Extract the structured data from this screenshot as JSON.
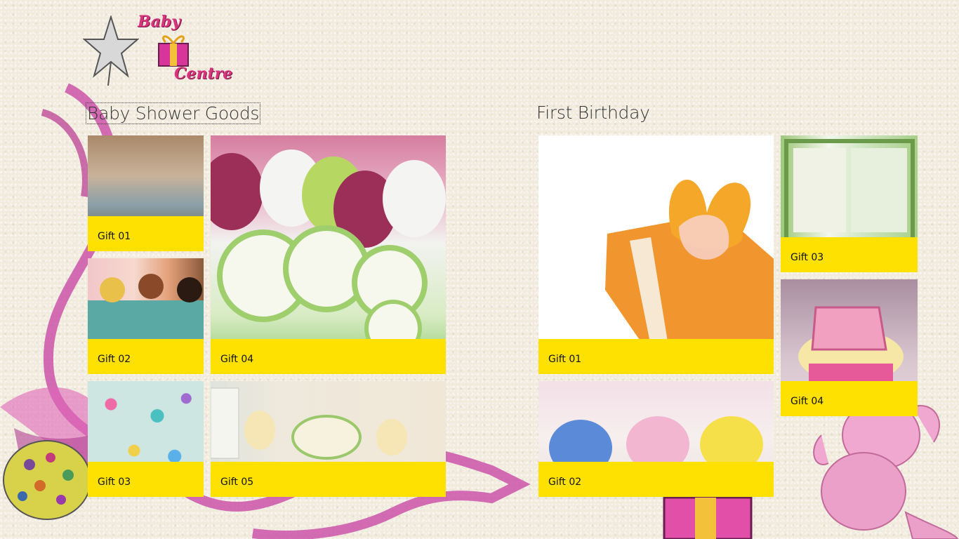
{
  "app": {
    "logo_line1": "Baby",
    "logo_line2": "Centre"
  },
  "sections": [
    {
      "title": "Baby Shower Goods",
      "tiles": [
        {
          "label": "Gift 01"
        },
        {
          "label": "Gift 04"
        },
        {
          "label": "Gift 02"
        },
        {
          "label": "Gift 03"
        },
        {
          "label": "Gift 05"
        }
      ]
    },
    {
      "title": "First Birthday",
      "tiles": [
        {
          "label": "Gift 01"
        },
        {
          "label": "Gift 03"
        },
        {
          "label": "Gift 04"
        },
        {
          "label": "Gift 02"
        }
      ]
    }
  ],
  "colors": {
    "caption_bg": "#ffe100",
    "background": "#f1ebdd",
    "logo_pink": "#d9357e"
  }
}
